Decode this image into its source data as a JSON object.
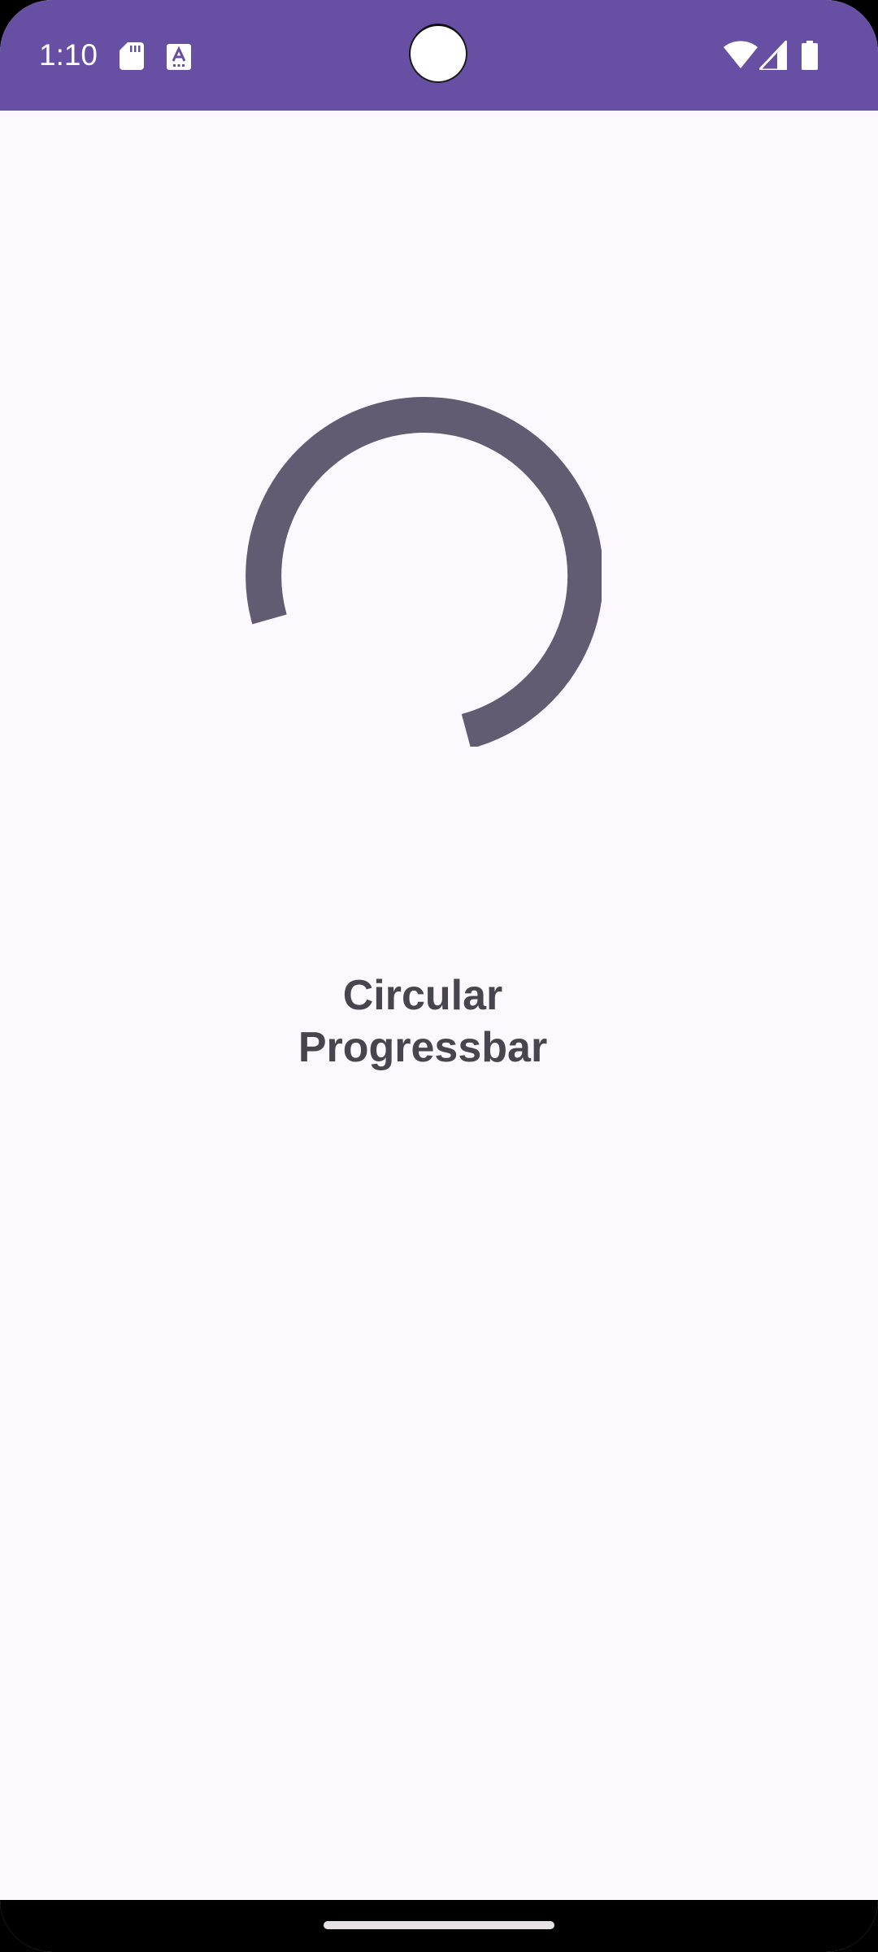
{
  "status_bar": {
    "time": "1:10",
    "icons": [
      "sd-card-icon",
      "text-a-icon",
      "wifi-icon",
      "cellular-signal-icon",
      "battery-icon"
    ],
    "background_color": "#6750A4"
  },
  "main": {
    "progress_indicator": {
      "type": "circular-indeterminate",
      "color": "#625B71"
    },
    "title": "Circular Progressbar",
    "background_color": "#FDF7FE"
  },
  "navigation": {
    "gesture_handle": "home-handle"
  }
}
